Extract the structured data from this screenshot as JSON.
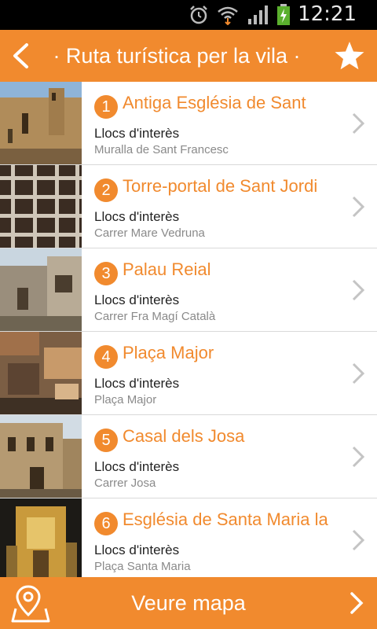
{
  "status_bar": {
    "time": "12:21"
  },
  "header": {
    "title": "· Ruta turística per la vila ·"
  },
  "places": [
    {
      "number": "1",
      "title": "Antiga Església de Sant",
      "category": "Llocs d'interès",
      "address": "Muralla de Sant Francesc"
    },
    {
      "number": "2",
      "title": "Torre-portal de Sant Jordi",
      "category": "Llocs d'interès",
      "address": "Carrer Mare Vedruna"
    },
    {
      "number": "3",
      "title": "Palau Reial",
      "category": "Llocs d'interès",
      "address": "Carrer Fra Magí Català"
    },
    {
      "number": "4",
      "title": "Plaça Major",
      "category": "Llocs d'interès",
      "address": "Plaça Major"
    },
    {
      "number": "5",
      "title": "Casal dels Josa",
      "category": "Llocs d'interès",
      "address": "Carrer Josa"
    },
    {
      "number": "6",
      "title": "Església de Santa Maria la",
      "category": "Llocs d'interès",
      "address": "Plaça Santa Maria"
    }
  ],
  "footer": {
    "label": "Veure mapa"
  },
  "colors": {
    "accent": "#f18a2e",
    "status_bar": "#000000"
  }
}
